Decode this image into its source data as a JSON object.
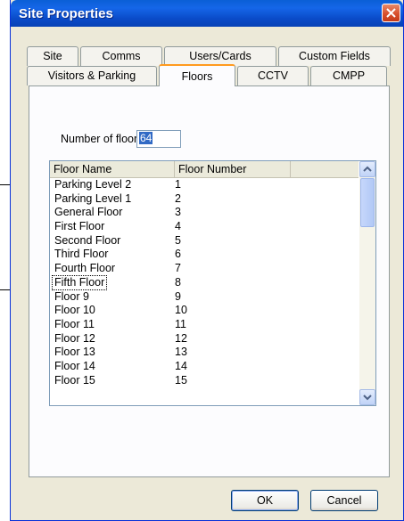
{
  "window": {
    "title": "Site Properties"
  },
  "tabs_row1": [
    "Site",
    "Comms",
    "Users/Cards",
    "Custom Fields"
  ],
  "tabs_row2": [
    "Visitors & Parking",
    "Floors",
    "CCTV",
    "CMPP"
  ],
  "active_tab": "Floors",
  "floors": {
    "label": "Number of floors:",
    "value": "64"
  },
  "list": {
    "columns": [
      "Floor Name",
      "Floor Number"
    ],
    "rows": [
      [
        "Parking Level 2",
        "1"
      ],
      [
        "Parking Level 1",
        "2"
      ],
      [
        "General Floor",
        "3"
      ],
      [
        "First Floor",
        "4"
      ],
      [
        "Second Floor",
        "5"
      ],
      [
        "Third Floor",
        "6"
      ],
      [
        "Fourth Floor",
        "7"
      ],
      [
        "Fifth Floor",
        "8"
      ],
      [
        "Floor 9",
        "9"
      ],
      [
        "Floor 10",
        "10"
      ],
      [
        "Floor 11",
        "11"
      ],
      [
        "Floor 12",
        "12"
      ],
      [
        "Floor 13",
        "13"
      ],
      [
        "Floor 14",
        "14"
      ],
      [
        "Floor 15",
        "15"
      ]
    ]
  },
  "buttons": {
    "ok": "OK",
    "cancel": "Cancel"
  },
  "colors": {
    "titlebar": "#0a5fd6",
    "dialog_bg": "#ece9d8",
    "active_tab_accent": "#ff9a1f",
    "selection": "#316ac5"
  },
  "icons": {
    "close": "close-icon",
    "scroll_up": "chevron-up-icon",
    "scroll_down": "chevron-down-icon"
  }
}
